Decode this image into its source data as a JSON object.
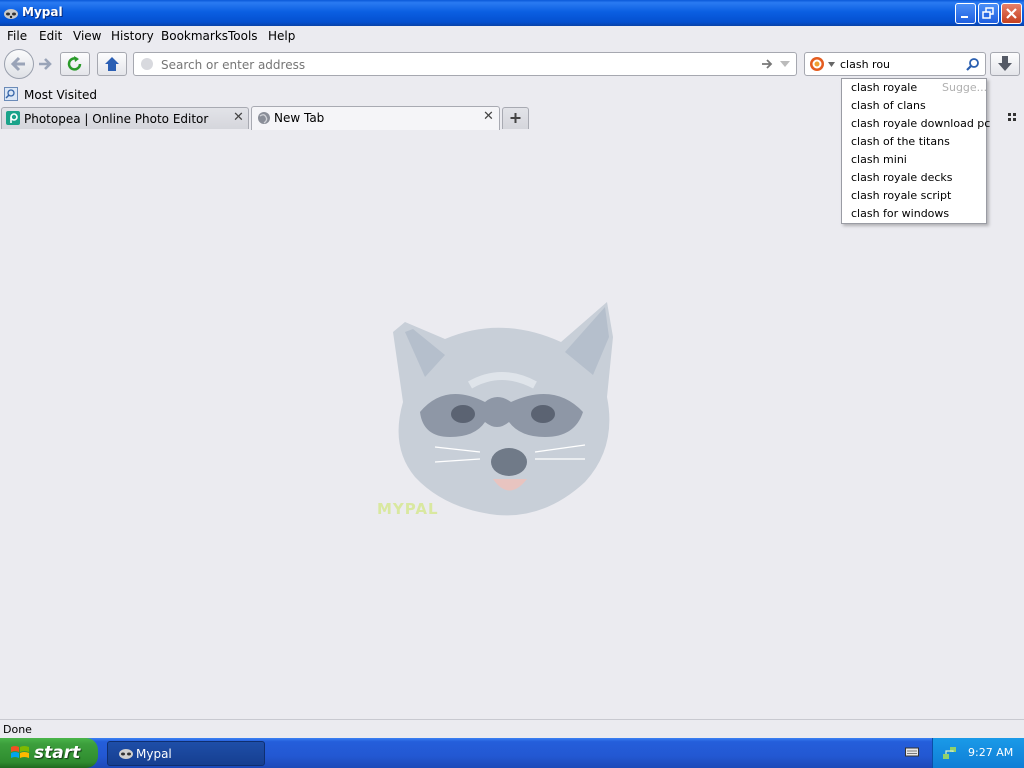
{
  "window": {
    "title": "Mypal"
  },
  "menu": [
    "File",
    "Edit",
    "View",
    "History",
    "Bookmarks",
    "Tools",
    "Help"
  ],
  "address_bar": {
    "placeholder": "Search or enter address"
  },
  "search_bar": {
    "value": "clash rou"
  },
  "bookmarks_toolbar": {
    "items": [
      "Most Visited"
    ]
  },
  "tabs": [
    {
      "label": "Photopea | Online Photo Editor",
      "active": false
    },
    {
      "label": "New Tab",
      "active": true
    }
  ],
  "suggestions": {
    "header": "Sugge...",
    "items": [
      "clash royale",
      "clash of clans",
      "clash royale download pc",
      "clash of the titans",
      "clash mini",
      "clash royale decks",
      "clash royale script",
      "clash for windows"
    ]
  },
  "content": {
    "logo_text": "MYPAL"
  },
  "status": {
    "text": "Done"
  },
  "taskbar": {
    "start_label": "start",
    "window_button": "Mypal",
    "clock": "9:27 AM"
  },
  "colors": {
    "titlebar": "#0b5fe2",
    "taskbar": "#245edb",
    "start_button": "#3c9f3c",
    "tray": "#0f7ed6",
    "logo_text": "#d9e8a0"
  }
}
